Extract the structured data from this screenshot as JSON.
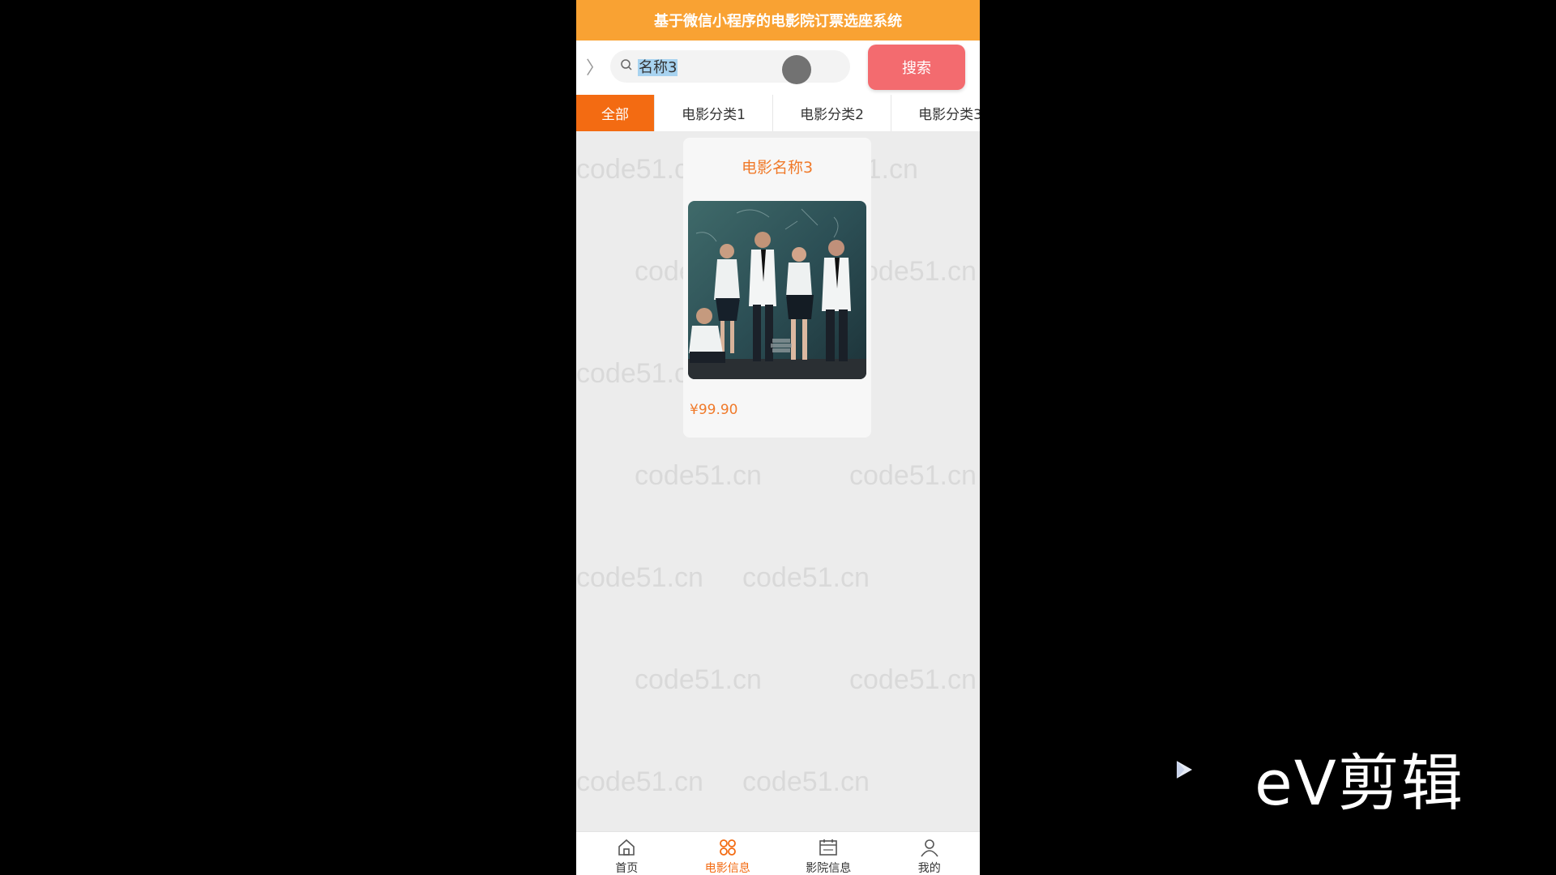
{
  "app": {
    "title": "基于微信小程序的电影院订票选座系统"
  },
  "search": {
    "back_glyph": "〉",
    "query": "名称3",
    "button_label": "搜索"
  },
  "tabs": [
    {
      "label": "全部",
      "active": true
    },
    {
      "label": "电影分类1",
      "active": false
    },
    {
      "label": "电影分类2",
      "active": false
    },
    {
      "label": "电影分类3",
      "active": false
    }
  ],
  "movie_card": {
    "title": "电影名称3",
    "price": "¥99.90"
  },
  "bottom_nav": [
    {
      "label": "首页",
      "icon": "home-icon",
      "active": false
    },
    {
      "label": "电影信息",
      "icon": "movie-info-icon",
      "active": true
    },
    {
      "label": "影院信息",
      "icon": "cinema-info-icon",
      "active": false
    },
    {
      "label": "我的",
      "icon": "user-icon",
      "active": false
    }
  ],
  "watermark_text": "code51.cn",
  "overlay_brand": "eV剪辑",
  "colors": {
    "header": "#f9a233",
    "accent": "#f36b12",
    "search_button": "#f36b6f",
    "price": "#f07a2a"
  }
}
